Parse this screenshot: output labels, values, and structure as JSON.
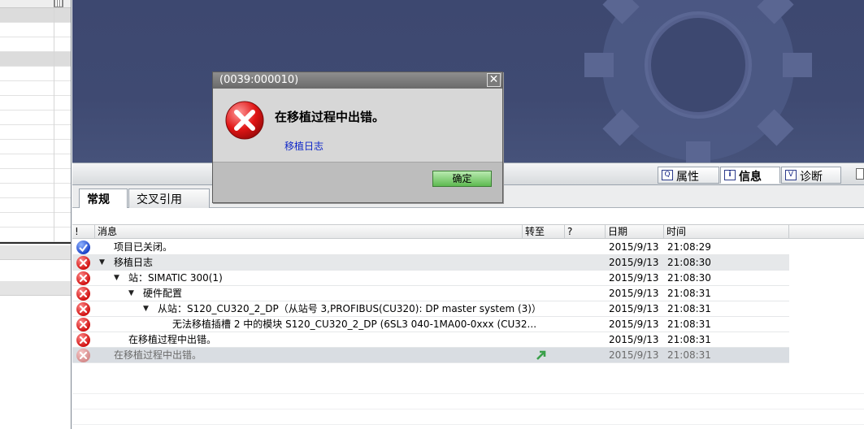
{
  "dialog": {
    "title": "(0039:000010)",
    "message": "在移植过程中出错。",
    "link": "移植日志",
    "ok_button": "确定",
    "close_symbol": "✕"
  },
  "inspector_tabs": [
    {
      "label": "属性",
      "icon": "properties-icon"
    },
    {
      "label": "信息",
      "icon": "info-icon"
    },
    {
      "label": "诊断",
      "icon": "diagnostics-icon"
    }
  ],
  "sub_tabs": [
    {
      "label": "常规"
    },
    {
      "label": "交叉引用"
    }
  ],
  "columns": {
    "bang": "!",
    "message": "消息",
    "goto": "转至",
    "question": "?",
    "date": "日期",
    "time": "时间"
  },
  "rows": [
    {
      "status": "ok",
      "level": 0,
      "arrow": "",
      "message": "项目已关闭。",
      "date": "2015/9/13",
      "time": "21:08:29"
    },
    {
      "status": "error",
      "level": 0,
      "arrow": "▼",
      "message": "移植日志",
      "date": "2015/9/13",
      "time": "21:08:30"
    },
    {
      "status": "error",
      "level": 1,
      "arrow": "▼",
      "message": "站：SIMATIC 300(1)",
      "date": "2015/9/13",
      "time": "21:08:30"
    },
    {
      "status": "error",
      "level": 2,
      "arrow": "▼",
      "message": "硬件配置",
      "date": "2015/9/13",
      "time": "21:08:31"
    },
    {
      "status": "error",
      "level": 3,
      "arrow": "▼",
      "message": "从站：S120_CU320_2_DP（从站号 3,PROFIBUS(CU320): DP master system (3)）",
      "date": "2015/9/13",
      "time": "21:08:31"
    },
    {
      "status": "error",
      "level": 4,
      "arrow": "",
      "message": "无法移植插槽 2 中的模块 S120_CU320_2_DP (6SL3 040-1MA00-0xxx (CU32...",
      "date": "2015/9/13",
      "time": "21:08:31"
    },
    {
      "status": "error",
      "level": 1,
      "arrow": "",
      "message": "在移植过程中出错。",
      "date": "2015/9/13",
      "time": "21:08:31"
    },
    {
      "status": "error-dim",
      "level": 0,
      "arrow": "",
      "message": "在移植过程中出错。",
      "date": "2015/9/13",
      "time": "21:08:31",
      "goto": true
    }
  ],
  "colors": {
    "workspace": "#3f4a72",
    "error": "#d11212",
    "ok": "#1d45c9",
    "link": "#1028c8",
    "ok_button": "#5fba51"
  }
}
